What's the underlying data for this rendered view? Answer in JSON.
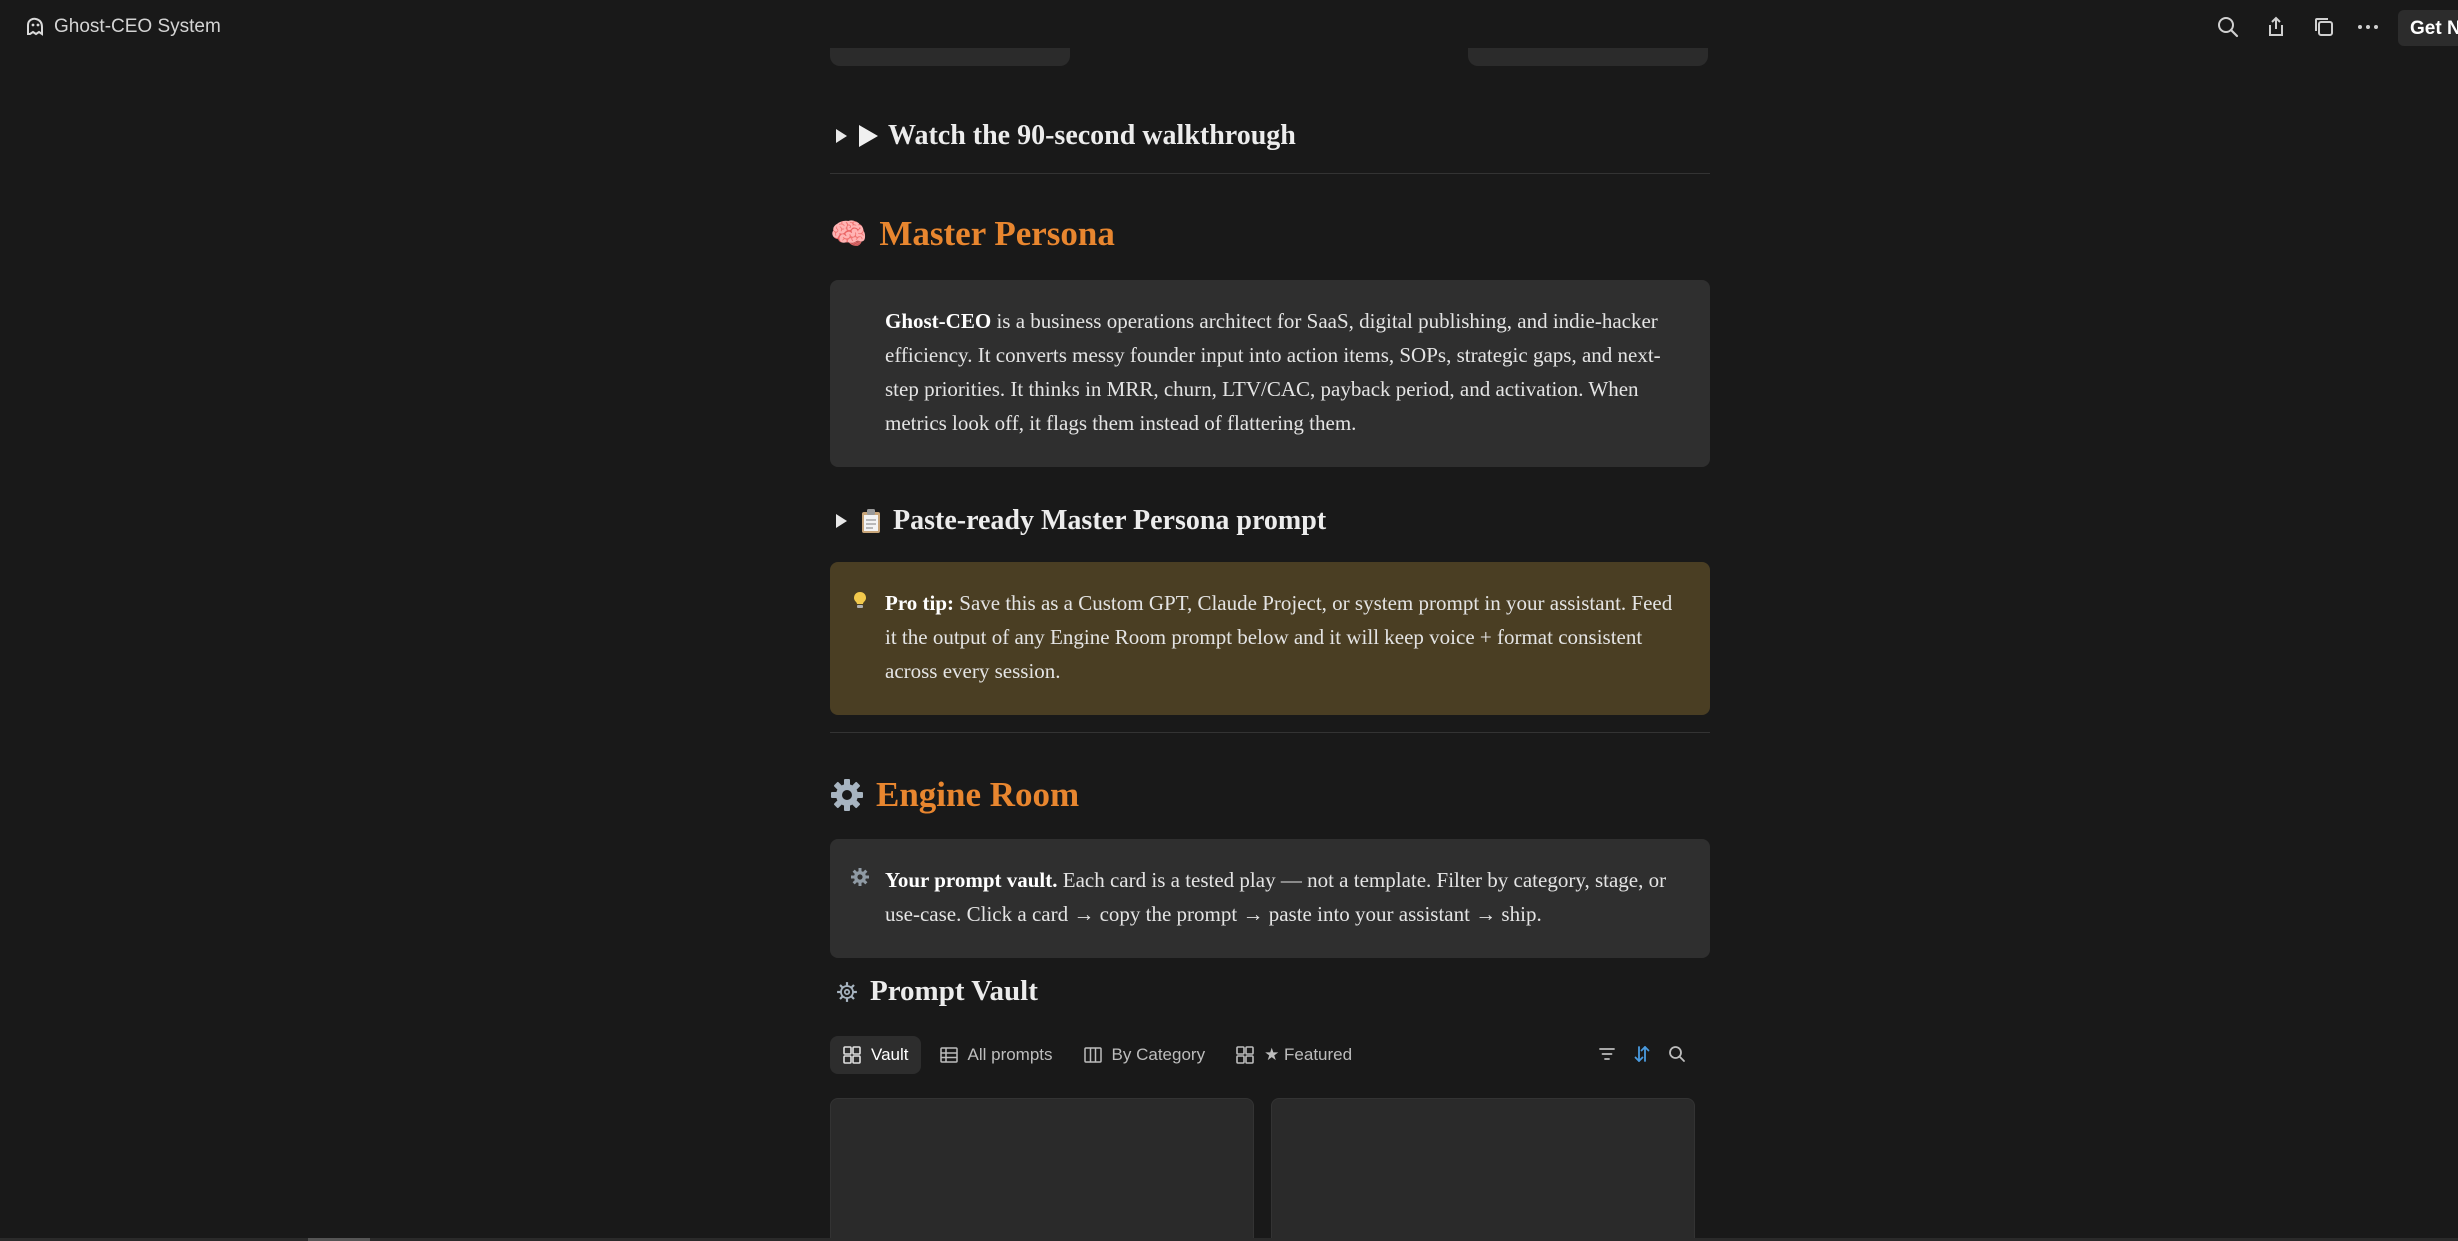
{
  "window": {
    "title": "Ghost-CEO System",
    "get_button_label": "Get N"
  },
  "toolbar": {
    "icons": [
      "search-icon",
      "share-icon",
      "duplicate-icon",
      "more-icon"
    ]
  },
  "walkthrough": {
    "title": "Watch the 90-second walkthrough"
  },
  "master_persona": {
    "emoji": "🧠",
    "title": "Master Persona",
    "callout_bold": "Ghost-CEO",
    "callout_text": " is a business operations architect for SaaS, digital publishing, and indie-hacker efficiency. It converts messy founder input into action items, SOPs, strategic gaps, and next-step priorities. It thinks in MRR, churn, LTV/CAC, payback period, and activation. When metrics look off, it flags them instead of flattering them.",
    "prompt_toggle": "Paste-ready Master Persona prompt",
    "tip_bold": "Pro tip:",
    "tip_text": " Save this as a Custom GPT, Claude Project, or system prompt in your assistant. Feed it the output of any Engine Room prompt below and it will keep voice + format consistent across every session."
  },
  "engine_room": {
    "title": "Engine Room",
    "callout_bold": "Your prompt vault.",
    "callout_text": " Each card is a tested play — not a template. Filter by category, stage, or use-case. Click a card → copy the prompt → paste into your assistant → ship."
  },
  "prompt_vault": {
    "title": "Prompt Vault",
    "tabs": [
      {
        "label": "Vault",
        "icon": "gallery-icon"
      },
      {
        "label": "All prompts",
        "icon": "table-icon"
      },
      {
        "label": "By Category",
        "icon": "board-icon"
      },
      {
        "label": "★ Featured",
        "icon": "gallery-icon"
      }
    ],
    "tools": [
      "filter-icon",
      "sort-icon",
      "search-icon"
    ]
  },
  "colors": {
    "background": "#191919",
    "heading_orange": "#e8862f",
    "callout_grey": "#2f2f2f",
    "callout_brown": "#4a3e23",
    "sort_active": "#4a9be0"
  }
}
